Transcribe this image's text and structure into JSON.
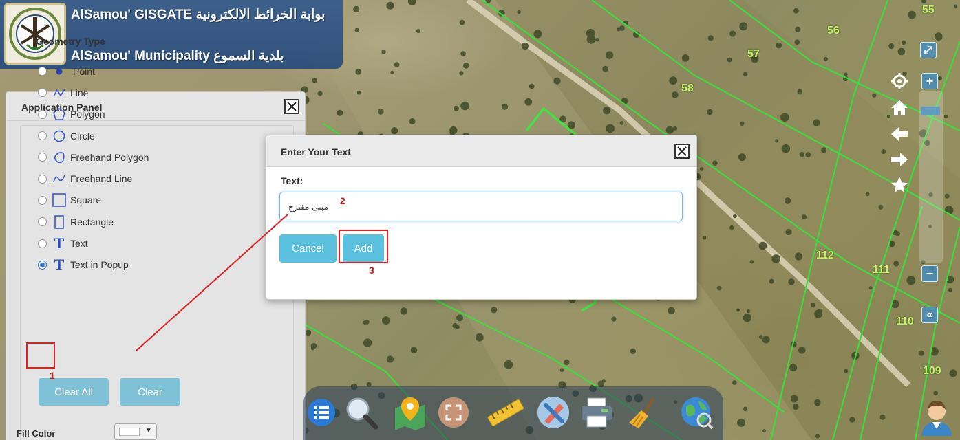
{
  "header": {
    "line1": "AlSamou' GISGATE بوابة الخرائط الالكترونية",
    "line2": "AlSamou' Municipality بلدية السموع"
  },
  "map": {
    "parcel_labels": [
      "55",
      "56",
      "57",
      "58",
      "112",
      "111",
      "110",
      "109"
    ],
    "parcel_line_color": "#3ddc3d"
  },
  "panel": {
    "title": "Application Panel",
    "geometry_legend": "Geometry Type",
    "items": [
      {
        "label": "Point",
        "icon": "point-icon",
        "checked": false
      },
      {
        "label": "Line",
        "icon": "line-icon",
        "checked": false
      },
      {
        "label": "Polygon",
        "icon": "polygon-icon",
        "checked": false
      },
      {
        "label": "Circle",
        "icon": "circle-icon",
        "checked": false
      },
      {
        "label": "Freehand Polygon",
        "icon": "freehand-polygon-icon",
        "checked": false
      },
      {
        "label": "Freehand Line",
        "icon": "freehand-line-icon",
        "checked": false
      },
      {
        "label": "Square",
        "icon": "square-icon",
        "checked": false
      },
      {
        "label": "Rectangle",
        "icon": "rectangle-icon",
        "checked": false
      },
      {
        "label": "Text",
        "icon": "text-icon",
        "checked": false
      },
      {
        "label": "Text in Popup",
        "icon": "text-icon",
        "checked": true
      }
    ],
    "clear_all_label": "Clear All",
    "clear_label": "Clear",
    "fill_color_label": "Fill Color"
  },
  "dialog": {
    "title": "Enter Your Text",
    "text_label": "Text:",
    "text_value": "مبنى مقترح",
    "cancel_label": "Cancel",
    "add_label": "Add"
  },
  "annotations": {
    "step1": "1",
    "step2": "2",
    "step3": "3",
    "color": "#e02020"
  },
  "toolbar": {
    "tools": [
      "layers-icon",
      "search-icon",
      "map-pin-icon",
      "fullscreen-icon",
      "measure-ruler-icon",
      "draw-tools-icon",
      "print-icon",
      "clear-broom-icon",
      "globe-icon"
    ]
  },
  "colors": {
    "header_bg": "#2f5483",
    "button": "#5bc0de",
    "panel_bg": "#e2e2e2"
  }
}
